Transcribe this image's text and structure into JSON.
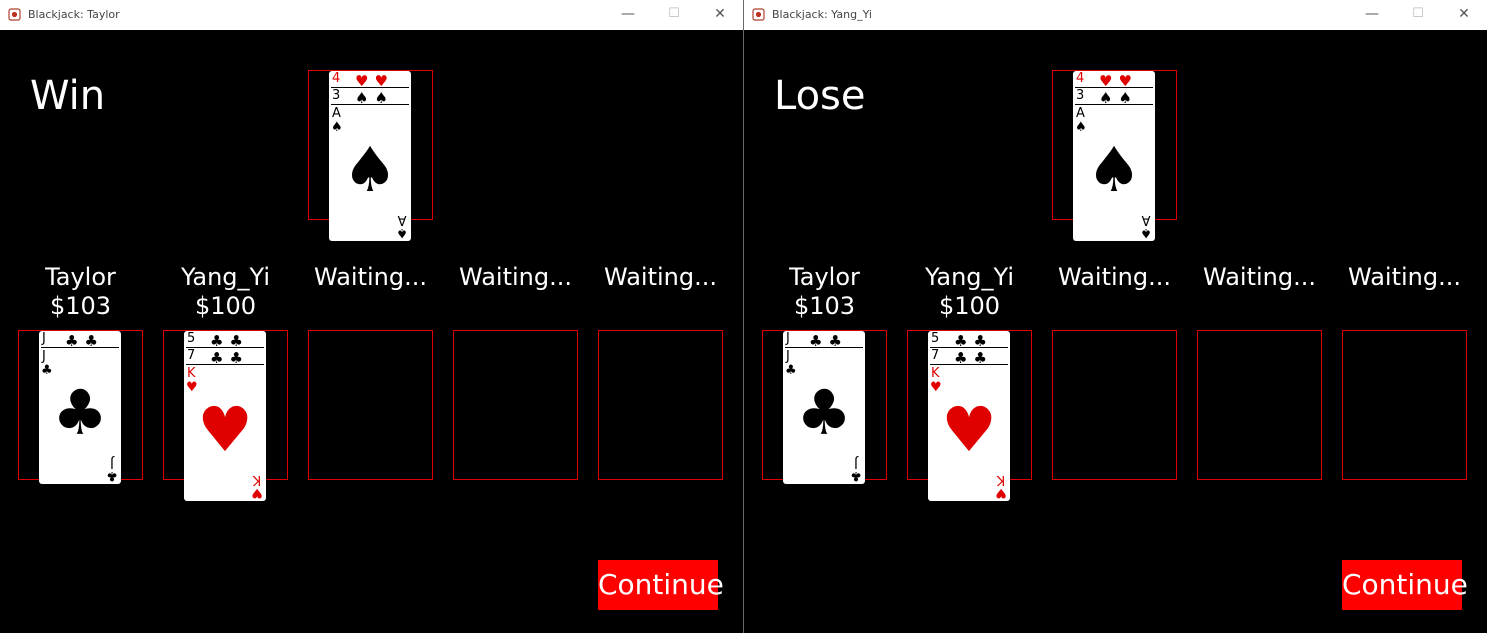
{
  "windows": [
    {
      "title": "Blackjack: Taylor",
      "result": "Win",
      "continue_label": "Continue"
    },
    {
      "title": "Blackjack: Yang_Yi",
      "result": "Lose",
      "continue_label": "Continue"
    }
  ],
  "titlebar_icons": {
    "minimize": "minimize-icon",
    "maximize": "maximize-icon",
    "close": "close-icon",
    "app": "app-icon"
  },
  "dealer": {
    "cards": [
      {
        "rank": "4",
        "suit": "♥",
        "color": "#e00000"
      },
      {
        "rank": "3",
        "suit": "♠",
        "color": "#000000"
      },
      {
        "rank": "A",
        "suit": "♠",
        "color": "#000000"
      }
    ]
  },
  "players": [
    {
      "name": "Taylor",
      "money": "$103",
      "cards": [
        {
          "rank": "J",
          "suit": "♣",
          "color": "#000000"
        },
        {
          "rank": "J",
          "suit": "♣",
          "color": "#000000"
        }
      ]
    },
    {
      "name": "Yang_Yi",
      "money": "$100",
      "cards": [
        {
          "rank": "5",
          "suit": "♣",
          "color": "#000000"
        },
        {
          "rank": "7",
          "suit": "♣",
          "color": "#000000"
        },
        {
          "rank": "K",
          "suit": "♥",
          "color": "#e00000"
        }
      ]
    },
    {
      "name": "Waiting...",
      "money": "",
      "cards": []
    },
    {
      "name": "Waiting...",
      "money": "",
      "cards": []
    },
    {
      "name": "Waiting...",
      "money": "",
      "cards": []
    }
  ],
  "colors": {
    "slot_border": "#e00000",
    "continue_bg": "#ff0000",
    "table_bg": "#000000",
    "red_suit": "#e00000"
  }
}
